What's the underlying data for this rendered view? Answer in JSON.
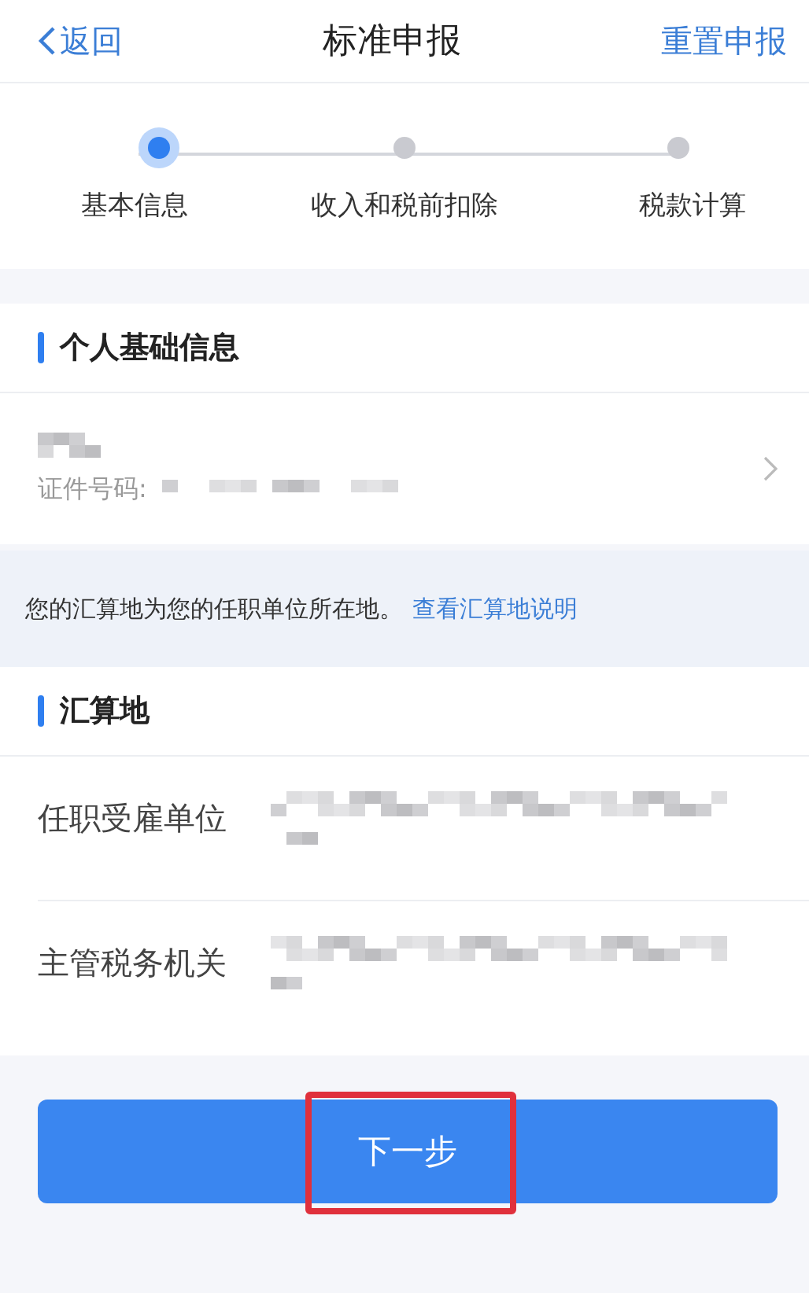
{
  "header": {
    "back": "返回",
    "title": "标准申报",
    "action": "重置申报"
  },
  "steps": [
    {
      "label": "基本信息",
      "selected": true
    },
    {
      "label": "收入和税前扣除",
      "selected": false
    },
    {
      "label": "税款计算",
      "selected": false
    }
  ],
  "personal": {
    "title": "个人基础信息",
    "id_label": "证件号码:"
  },
  "notice": {
    "text": "您的汇算地为您的任职单位所在地。",
    "link": "查看汇算地说明"
  },
  "location": {
    "title": "汇算地",
    "rows": [
      {
        "label": "任职受雇单位"
      },
      {
        "label": "主管税务机关"
      }
    ]
  },
  "next_button": {
    "label": "下一步",
    "highlighted": true
  }
}
